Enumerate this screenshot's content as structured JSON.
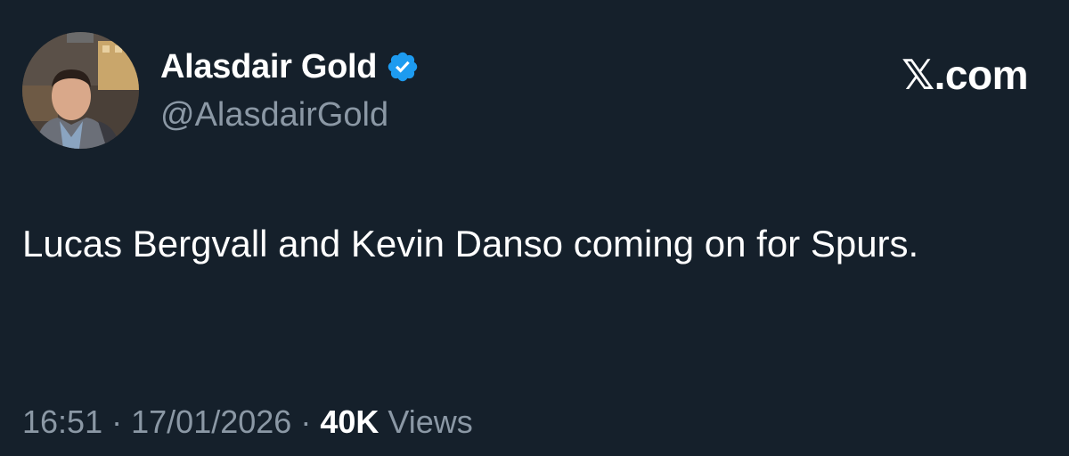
{
  "author": {
    "name": "Alasdair Gold",
    "handle": "@AlasdairGold",
    "verified": true,
    "avatar_icon": "profile-photo"
  },
  "brand": {
    "label": "𝕏.com"
  },
  "tweet": {
    "text": "Lucas Bergvall and Kevin Danso coming on for Spurs."
  },
  "meta": {
    "time": "16:51",
    "separator": "·",
    "date": "17/01/2026",
    "views_count": "40K",
    "views_label": "Views"
  },
  "colors": {
    "background": "#15202b",
    "primary_text": "#ffffff",
    "secondary_text": "#8b98a5",
    "verified_badge": "#1d9bf0"
  }
}
